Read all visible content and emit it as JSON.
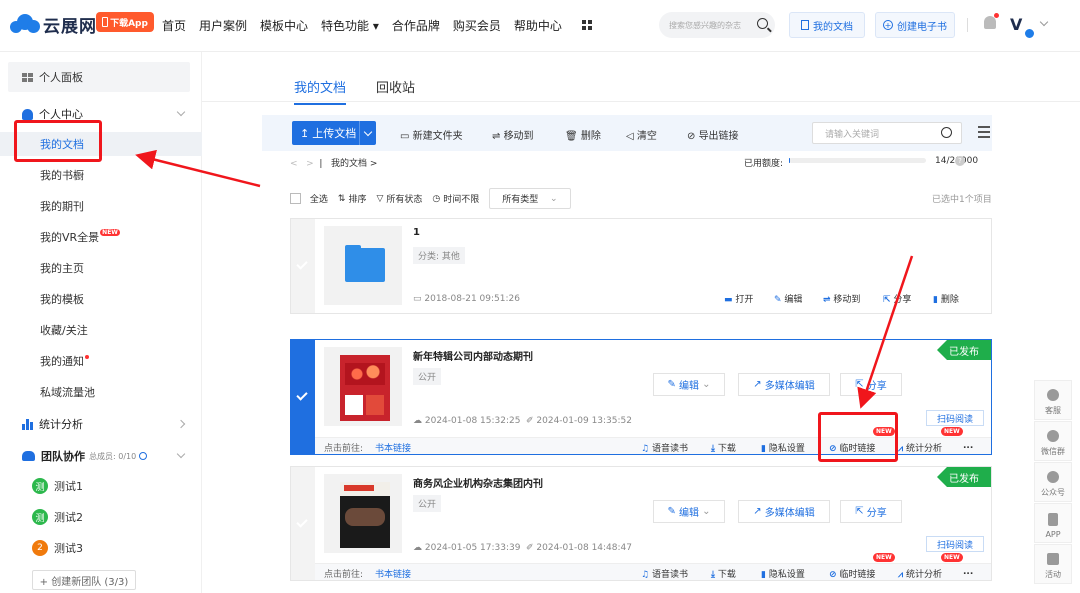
{
  "brand": {
    "name": "云展网",
    "app_badge": "下载App"
  },
  "nav": [
    "首页",
    "用户案例",
    "模板中心",
    "特色功能 ▾",
    "合作品牌",
    "购买会员",
    "帮助中心"
  ],
  "top_search_placeholder": "搜索您感兴趣的杂志",
  "top_buttons": {
    "my_docs": "我的文档",
    "create_ebook": "创建电子书"
  },
  "avatar_letter": "V",
  "sidebar": {
    "panel": "个人面板",
    "personal_center": "个人中心",
    "items": [
      "我的文档",
      "我的书橱",
      "我的期刊",
      "我的VR全景",
      "我的主页",
      "我的模板",
      "收藏/关注",
      "我的通知",
      "私域流量池"
    ],
    "vr_new": "NEW",
    "stats": "统计分析",
    "team": "团队协作",
    "team_count": "总成员: 0/10",
    "teams": [
      {
        "name": "测试1",
        "badge": "测",
        "color": "#2db84d"
      },
      {
        "name": "测试2",
        "badge": "测",
        "color": "#2db84d"
      },
      {
        "name": "测试3",
        "badge": "2",
        "color": "#f07a0c"
      }
    ],
    "create_team": "+ 创建新团队 (3/3)"
  },
  "tabs": [
    "我的文档",
    "回收站"
  ],
  "toolbar": {
    "upload": "上传文档",
    "new_folder": "新建文件夹",
    "move": "移动到",
    "delete": "删除",
    "clear": "清空",
    "export": "导出链接",
    "keyword_placeholder": "请输入关键词"
  },
  "breadcrumb": "我的文档 >",
  "quota": {
    "label": "已用额度:",
    "used": 14,
    "total": 20000,
    "text": "14/20000",
    "help": "?"
  },
  "filters": {
    "select_all": "全选",
    "sort": "排序",
    "status": "所有状态",
    "time": "时间不限",
    "type": "所有类型",
    "selected": "已选中1个项目"
  },
  "folder": {
    "title": "1",
    "category": "分类: 其他",
    "date": "2018-08-21 09:51:26",
    "actions": [
      "打开",
      "编辑",
      "移动到",
      "分享",
      "删除"
    ]
  },
  "docs": [
    {
      "title": "新年特辑公司内部动态期刊",
      "visibility": "公开",
      "status": "已发布",
      "created": "2024-01-08 15:32:25",
      "updated": "2024-01-09 13:35:52",
      "edit": "编辑",
      "media_edit": "多媒体编辑",
      "share": "分享",
      "scan": "扫码阅读",
      "goto": "点击前往:",
      "link": "书本链接",
      "footer": [
        "语音读书",
        "下载",
        "隐私设置",
        "临时链接",
        "统计分析",
        "..."
      ],
      "selected": true
    },
    {
      "title": "商务风企业机构杂志集团内刊",
      "visibility": "公开",
      "status": "已发布",
      "created": "2024-01-05 17:33:39",
      "updated": "2024-01-08 14:48:47",
      "edit": "编辑",
      "media_edit": "多媒体编辑",
      "share": "分享",
      "scan": "扫码阅读",
      "goto": "点击前往:",
      "link": "书本链接",
      "footer": [
        "语音读书",
        "下载",
        "隐私设置",
        "临时链接",
        "统计分析",
        "..."
      ],
      "selected": false
    }
  ],
  "new_tag": "NEW",
  "rail": [
    "客服",
    "微信群",
    "公众号",
    "APP",
    "活动"
  ]
}
